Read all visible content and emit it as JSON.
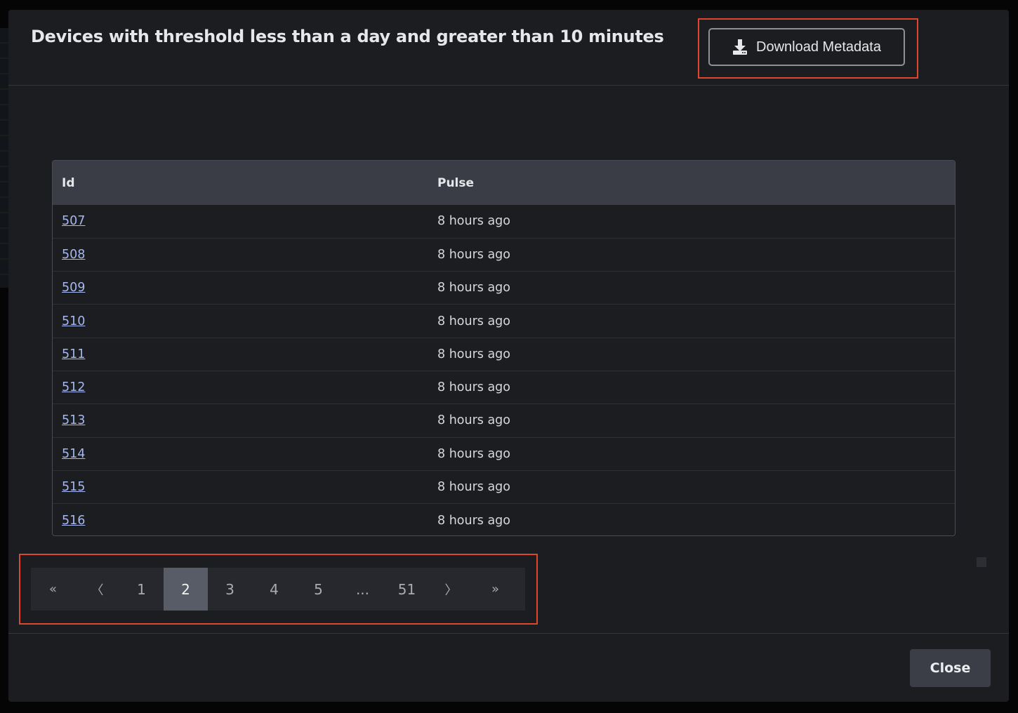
{
  "modal": {
    "title": "Devices with threshold less than a day and greater than 10 minutes",
    "download_label": "Download Metadata",
    "download_icon": "download-icon",
    "close_label": "Close"
  },
  "table": {
    "headers": {
      "id": "Id",
      "pulse": "Pulse"
    },
    "rows": [
      {
        "id": "507",
        "pulse": "8 hours ago"
      },
      {
        "id": "508",
        "pulse": "8 hours ago"
      },
      {
        "id": "509",
        "pulse": "8 hours ago"
      },
      {
        "id": "510",
        "pulse": "8 hours ago"
      },
      {
        "id": "511",
        "pulse": "8 hours ago"
      },
      {
        "id": "512",
        "pulse": "8 hours ago"
      },
      {
        "id": "513",
        "pulse": "8 hours ago"
      },
      {
        "id": "514",
        "pulse": "8 hours ago"
      },
      {
        "id": "515",
        "pulse": "8 hours ago"
      },
      {
        "id": "516",
        "pulse": "8 hours ago"
      }
    ]
  },
  "pagination": {
    "first": "«",
    "prev": "〈",
    "pages": [
      "1",
      "2",
      "3",
      "4",
      "5",
      "...",
      "51"
    ],
    "active_page": "2",
    "next": "〉",
    "last": "»"
  },
  "colors": {
    "modal_bg": "#1c1d21",
    "header_row_bg": "#3a3d45",
    "link": "#a6b8ee",
    "active_page_bg": "#585c66",
    "highlight": "#e0452e"
  }
}
